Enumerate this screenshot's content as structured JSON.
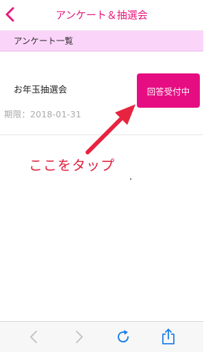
{
  "nav": {
    "title": "アンケート＆抽選会",
    "accent_color": "#e8157b",
    "back_icon": "chevron-left-icon"
  },
  "section": {
    "title": "アンケート一覧",
    "background_color": "#fbd4fa"
  },
  "items": [
    {
      "title": "お年玉抽選会",
      "deadline": "期限：2018-01-31",
      "status_label": "回答受付中",
      "status_color": "#e60d82"
    }
  ],
  "annotation": {
    "text": "ここをタップ",
    "color": "#e1203e",
    "arrow_icon": "arrow-pointer-icon"
  },
  "toolbar": {
    "icons": [
      "back-arrow-icon",
      "forward-arrow-icon",
      "reload-icon",
      "share-icon"
    ]
  }
}
